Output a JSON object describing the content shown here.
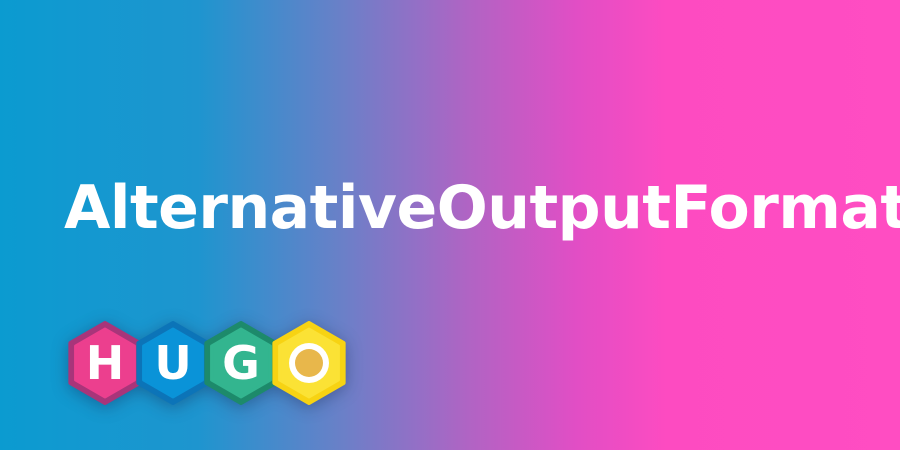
{
  "title": "AlternativeOutputFormats",
  "logo": {
    "name": "HUGO",
    "letters": [
      {
        "char": "H",
        "fill": "#ec3f8e",
        "rim": "#a8357a",
        "glyph": "#ffffff"
      },
      {
        "char": "U",
        "fill": "#0a93d8",
        "rim": "#0c74b8",
        "glyph": "#ffffff"
      },
      {
        "char": "G",
        "fill": "#33b58f",
        "rim": "#1d8a6b",
        "glyph": "#ffffff"
      },
      {
        "char": "O",
        "fill": "#fbe235",
        "rim": "#f7d313",
        "glyph": "#e8b74b"
      }
    ]
  },
  "colors": {
    "gradient_start": "#0b9bd0",
    "gradient_end": "#ff4dc2",
    "title_text": "#ffffff"
  }
}
